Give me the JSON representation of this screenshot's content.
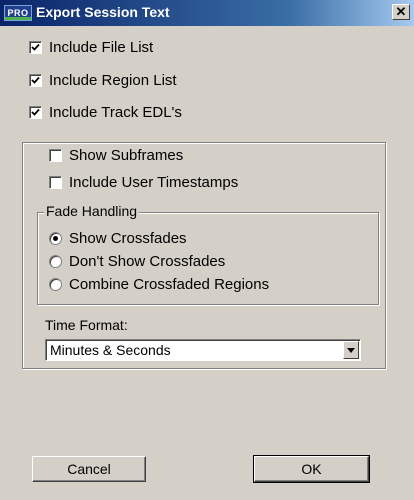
{
  "window": {
    "title": "Export Session Text",
    "icon_label": "PRO",
    "close_glyph": "✕"
  },
  "options": [
    {
      "label": "Include File List",
      "checked": true
    },
    {
      "label": "Include Region List",
      "checked": true
    },
    {
      "label": "Include Track EDL's",
      "checked": true
    }
  ],
  "track_options": [
    {
      "label": "Show Subframes",
      "checked": false
    },
    {
      "label": "Include User Timestamps",
      "checked": false
    }
  ],
  "fade_handling": {
    "label": "Fade Handling",
    "options": [
      {
        "label": "Show Crossfades",
        "selected": true
      },
      {
        "label": "Don't Show Crossfades",
        "selected": false
      },
      {
        "label": "Combine Crossfaded Regions",
        "selected": false
      }
    ]
  },
  "time_format": {
    "label": "Time Format:",
    "value": "Minutes & Seconds"
  },
  "buttons": {
    "cancel": "Cancel",
    "ok": "OK"
  }
}
